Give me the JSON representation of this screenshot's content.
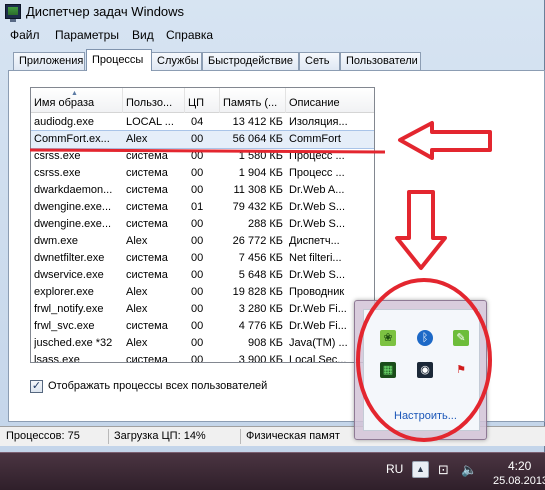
{
  "window": {
    "title": "Диспетчер задач Windows"
  },
  "menu": [
    "Файл",
    "Параметры",
    "Вид",
    "Справка"
  ],
  "tabs": [
    "Приложения",
    "Процессы",
    "Службы",
    "Быстродействие",
    "Сеть",
    "Пользователи"
  ],
  "active_tab": "Процессы",
  "table": {
    "columns": [
      "Имя образа",
      "Пользо...",
      "ЦП",
      "Память (...",
      "Описание"
    ],
    "rows": [
      [
        "audiodg.exe",
        "LOCAL ...",
        "04",
        "13 412 КБ",
        "Изоляция..."
      ],
      [
        "CommFort.ex...",
        "Alex",
        "00",
        "56 064 КБ",
        "CommFort"
      ],
      [
        "csrss.exe",
        "система",
        "00",
        "1 580 КБ",
        "Процесс ..."
      ],
      [
        "csrss.exe",
        "система",
        "00",
        "1 904 КБ",
        "Процесс ..."
      ],
      [
        "dwarkdaemon...",
        "система",
        "00",
        "11 308 КБ",
        "Dr.Web A..."
      ],
      [
        "dwengine.exe...",
        "система",
        "01",
        "79 432 КБ",
        "Dr.Web S..."
      ],
      [
        "dwengine.exe...",
        "система",
        "00",
        "288 КБ",
        "Dr.Web S..."
      ],
      [
        "dwm.exe",
        "Alex",
        "00",
        "26 772 КБ",
        "Диспетч..."
      ],
      [
        "dwnetfilter.exe",
        "система",
        "00",
        "7 456 КБ",
        "Net filteri..."
      ],
      [
        "dwservice.exe",
        "система",
        "00",
        "5 648 КБ",
        "Dr.Web S..."
      ],
      [
        "explorer.exe",
        "Alex",
        "00",
        "19 828 КБ",
        "Проводник"
      ],
      [
        "frwl_notify.exe",
        "Alex",
        "00",
        "3 280 КБ",
        "Dr.Web Fi..."
      ],
      [
        "frwl_svc.exe",
        "система",
        "00",
        "4 776 КБ",
        "Dr.Web Fi..."
      ],
      [
        "jusched.exe *32",
        "Alex",
        "00",
        "908 КБ",
        "Java(TM) ..."
      ],
      [
        "lsass.exe",
        "система",
        "00",
        "3 900 КБ",
        "Local Sec..."
      ]
    ],
    "selected_row": 1
  },
  "show_all_users": {
    "label": "Отображать процессы всех пользователей",
    "checked": true
  },
  "status": {
    "processes": "Процессов: 75",
    "cpu": "Загрузка ЦП: 14%",
    "memory": "Физическая памят"
  },
  "taskbar": {
    "language": "RU",
    "time": "4:20",
    "date": "25.08.2013"
  },
  "tray_popup": {
    "link": "Настроить...",
    "icons": [
      "frog-icon",
      "bluetooth-icon",
      "evernote-icon",
      "process-icon",
      "steam-icon",
      "flag-error-icon"
    ]
  },
  "colors": {
    "annotation": "#e3262f",
    "selection": "#e5eef9",
    "link": "#1a56b8"
  }
}
